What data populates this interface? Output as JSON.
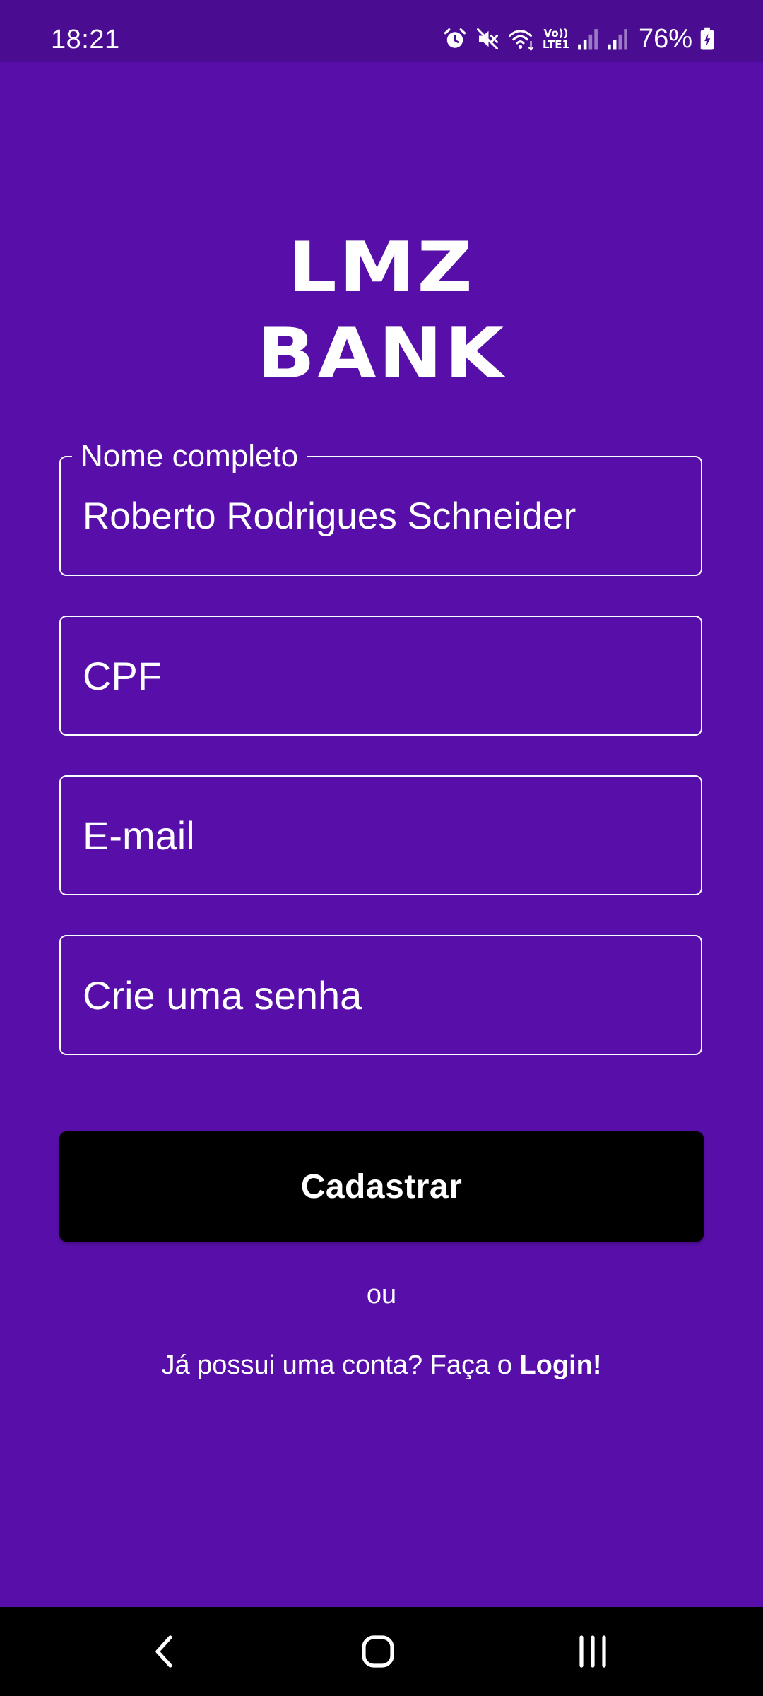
{
  "status_bar": {
    "time": "18:21",
    "network_label_top": "Vo))",
    "network_label_bottom": "LTE1",
    "battery_percent": "76%",
    "icons": [
      "alarm-icon",
      "mute-icon",
      "wifi-icon",
      "volte-icon",
      "signal-icon",
      "signal-icon",
      "battery-charging-icon"
    ]
  },
  "logo": {
    "line1": "LMZ",
    "line2": "BANK"
  },
  "form": {
    "full_name": {
      "label": "Nome completo",
      "value": "Roberto Rodrigues Schneider"
    },
    "cpf": {
      "placeholder": "CPF"
    },
    "email": {
      "placeholder": "E-mail"
    },
    "password": {
      "placeholder": "Crie uma senha"
    },
    "submit_label": "Cadastrar"
  },
  "footer": {
    "or_text": "ou",
    "login_prompt": "Já possui uma conta? Faça o ",
    "login_link": "Login!"
  },
  "nav_bar": {
    "icons": [
      "back-icon",
      "home-icon",
      "recents-icon"
    ]
  },
  "colors": {
    "background": "#580fa9",
    "status_bar": "#4a0d92",
    "button": "#000000",
    "text": "#ffffff"
  }
}
